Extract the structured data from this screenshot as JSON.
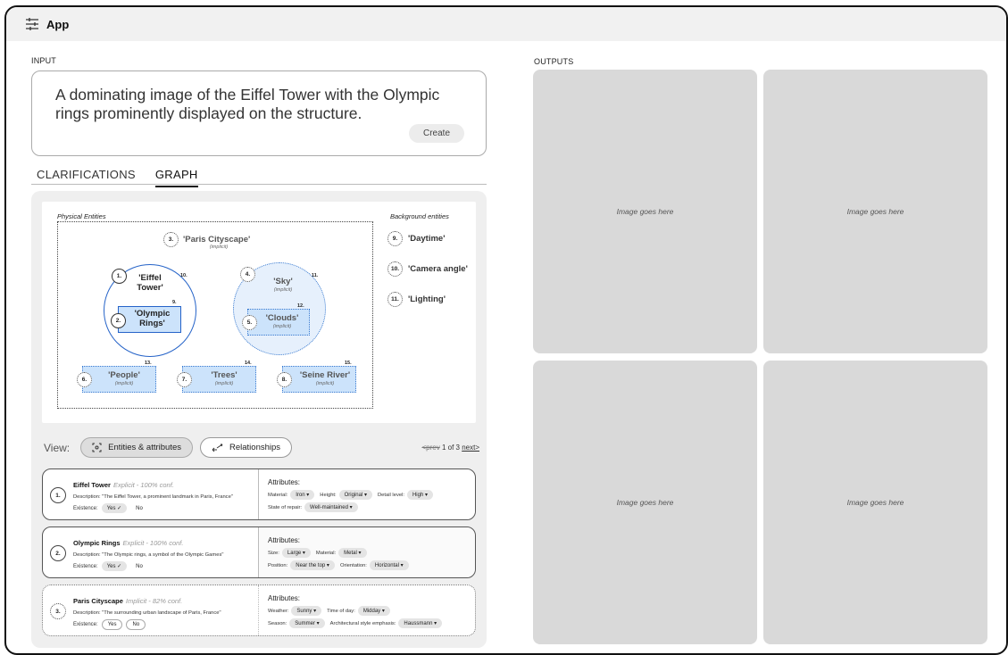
{
  "app": {
    "title": "App"
  },
  "input": {
    "label": "INPUT",
    "prompt": "A dominating image of the Eiffel Tower with the Olympic rings prominently displayed on the structure.",
    "create_label": "Create"
  },
  "tabs": [
    {
      "label": "CLARIFICATIONS"
    },
    {
      "label": "GRAPH"
    }
  ],
  "graph": {
    "physical_label": "Physical Entities",
    "background_label": "Background entities",
    "entities": [
      {
        "num": "1.",
        "name": "'Eiffel Tower'",
        "idx": "10."
      },
      {
        "num": "2.",
        "name": "'Olympic Rings'",
        "idx": "9."
      },
      {
        "num": "3.",
        "name": "'Paris Cityscape'",
        "sub": "(implicit)"
      },
      {
        "num": "4.",
        "name": "'Sky'",
        "sub": "(implicit)",
        "idx": "11."
      },
      {
        "num": "5.",
        "name": "'Clouds'",
        "sub": "(implicit)",
        "idx": "12."
      },
      {
        "num": "6.",
        "name": "'People'",
        "sub": "(implicit)",
        "idx": "13."
      },
      {
        "num": "7.",
        "name": "'Trees'",
        "sub": "(implicit)",
        "idx": "14."
      },
      {
        "num": "8.",
        "name": "'Seine River'",
        "sub": "(implicit)",
        "idx": "15."
      }
    ],
    "background": [
      {
        "num": "9.",
        "name": "'Daytime'"
      },
      {
        "num": "10.",
        "name": "'Camera angle'"
      },
      {
        "num": "11.",
        "name": "'Lighting'"
      }
    ]
  },
  "view": {
    "label": "View:",
    "entities_btn": "Entities & attributes",
    "relationships_btn": "Relationships",
    "prev": "<prev",
    "page": "1 of 3",
    "next": "next>"
  },
  "cards": [
    {
      "num": "1.",
      "title": "Eiffel Tower",
      "conf": "Explicit - 100% conf.",
      "description": "Description: \"The Eiffel Tower, a prominent landmark in Paris, France\"",
      "existence_label": "Existence:",
      "yes": "Yes ✓",
      "no": "No",
      "attr_header": "Attributes:",
      "attr_rows": [
        [
          {
            "k": "Material:",
            "v": "Iron ▾"
          },
          {
            "k": "Height:",
            "v": "Original ▾"
          },
          {
            "k": "Detail level:",
            "v": "High ▾"
          }
        ],
        [
          {
            "k": "State of repair:",
            "v": "Well-maintained ▾"
          }
        ]
      ]
    },
    {
      "num": "2.",
      "title": "Olympic Rings",
      "conf": "Explicit - 100% conf.",
      "description": "Description: \"The Olympic rings, a symbol of the Olympic Games\"",
      "existence_label": "Existence:",
      "yes": "Yes ✓",
      "no": "No",
      "attr_header": "Attributes:",
      "attr_rows": [
        [
          {
            "k": "Size:",
            "v": "Large ▾"
          },
          {
            "k": "Material:",
            "v": "Metal ▾"
          }
        ],
        [
          {
            "k": "Position:",
            "v": "Near the top ▾"
          },
          {
            "k": "Orientation:",
            "v": "Horizontal ▾"
          }
        ]
      ]
    },
    {
      "num": "3.",
      "title": "Paris Cityscape",
      "conf": "Implicit - 82% conf.",
      "description": "Description: \"The surrounding urban landscape of Paris, France\"",
      "existence_label": "Existence:",
      "yes": "Yes",
      "no": "No",
      "attr_header": "Attributes:",
      "attr_rows": [
        [
          {
            "k": "Weather:",
            "v": "Sunny ▾"
          },
          {
            "k": "Time of day:",
            "v": "Midday ▾"
          }
        ],
        [
          {
            "k": "Season:",
            "v": "Summer ▾"
          },
          {
            "k": "Architectural style emphasis:",
            "v": "Haussmann ▾"
          }
        ]
      ]
    }
  ],
  "outputs": {
    "label": "OUTPUTS",
    "placeholders": [
      "Image goes here",
      "Image goes here",
      "Image goes here",
      "Image goes here"
    ]
  }
}
